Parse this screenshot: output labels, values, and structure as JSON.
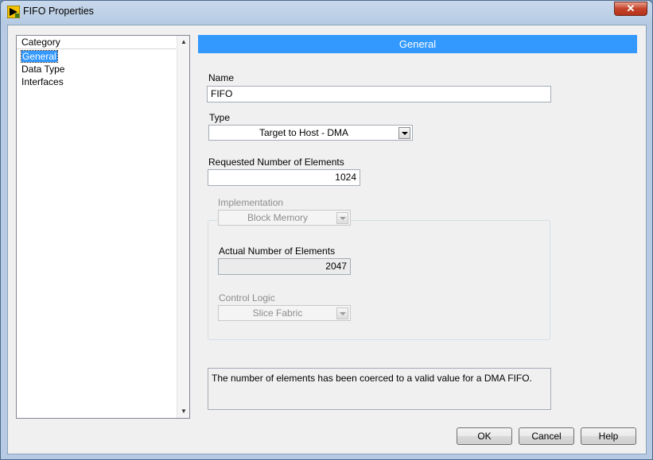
{
  "window": {
    "title": "FIFO Properties",
    "close_glyph": "✕"
  },
  "icons": {
    "app": "labview-icon",
    "close": "close-icon",
    "scroll_up": "scroll-up-arrow-icon",
    "scroll_down": "scroll-down-arrow-icon",
    "dropdown": "chevron-down-icon"
  },
  "sidebar": {
    "header": "Category",
    "items": [
      {
        "label": "General",
        "selected": true
      },
      {
        "label": "Data Type",
        "selected": false
      },
      {
        "label": "Interfaces",
        "selected": false
      }
    ],
    "scroll_up": "▲",
    "scroll_down": "▼"
  },
  "main": {
    "section_title": "General",
    "name_label": "Name",
    "name_value": "FIFO",
    "type_label": "Type",
    "type_value": "Target to Host - DMA",
    "requested_label": "Requested Number of Elements",
    "requested_value": "1024",
    "implementation_label": "Implementation",
    "implementation_value": "Block Memory",
    "actual_label": "Actual Number of Elements",
    "actual_value": "2047",
    "control_logic_label": "Control Logic",
    "control_logic_value": "Slice Fabric",
    "message": "The number of elements has been coerced to a valid value for a DMA FIFO."
  },
  "buttons": {
    "ok": "OK",
    "cancel": "Cancel",
    "help": "Help"
  },
  "colors": {
    "selection": "#3399ff",
    "section_bar": "#3399ff",
    "close_button": "#c5432a"
  }
}
